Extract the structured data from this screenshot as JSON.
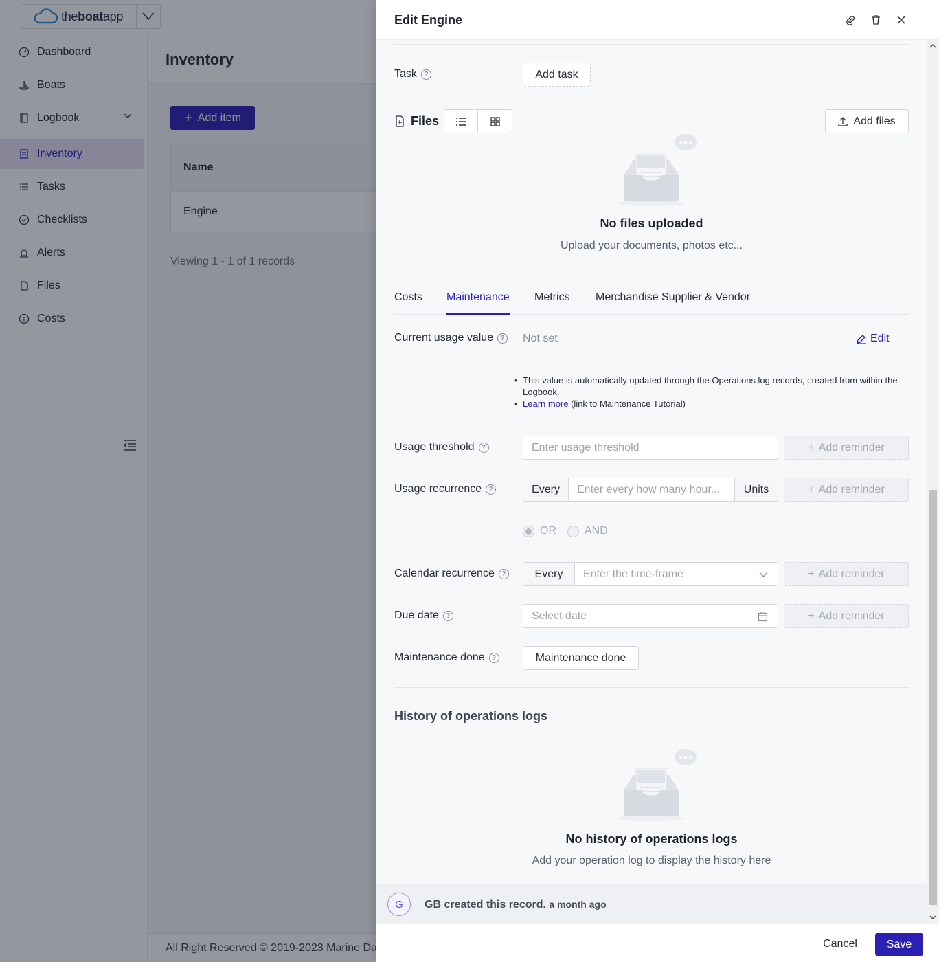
{
  "app": {
    "brand_light": "the",
    "brand_bold": "boat",
    "brand_tail": "app"
  },
  "sidebar": {
    "items": [
      {
        "label": "Dashboard",
        "icon": "dashboard-icon"
      },
      {
        "label": "Boats",
        "icon": "boat-icon"
      },
      {
        "label": "Logbook",
        "icon": "logbook-icon"
      },
      {
        "label": "Inventory",
        "icon": "inventory-icon"
      },
      {
        "label": "Tasks",
        "icon": "tasks-icon"
      },
      {
        "label": "Checklists",
        "icon": "checklist-icon"
      },
      {
        "label": "Alerts",
        "icon": "alert-icon"
      },
      {
        "label": "Files",
        "icon": "file-icon"
      },
      {
        "label": "Costs",
        "icon": "dollar-icon"
      }
    ],
    "active": "Inventory"
  },
  "main": {
    "title": "Inventory",
    "add_item_label": "Add item",
    "table": {
      "columns": [
        "Name"
      ],
      "rows": [
        [
          "Engine"
        ]
      ]
    },
    "viewing": "Viewing 1 - 1 of 1 records",
    "footer": "All Right Reserved © 2019-2023 Marine Da"
  },
  "drawer": {
    "title": "Edit Engine",
    "task": {
      "label": "Task",
      "button": "Add task"
    },
    "files": {
      "title": "Files",
      "add_button": "Add files",
      "empty_title": "No files uploaded",
      "empty_sub": "Upload your documents, photos etc..."
    },
    "tabs": [
      "Costs",
      "Maintenance",
      "Metrics",
      "Merchandise Supplier & Vendor"
    ],
    "active_tab": "Maintenance",
    "current_usage": {
      "label": "Current usage value",
      "value": "Not set",
      "edit": "Edit",
      "note1": "This value is automatically updated through the Operations log records, created from within the Logbook.",
      "note2_link": "Learn more",
      "note2_rest": " (link to Maintenance Tutorial)"
    },
    "usage_threshold": {
      "label": "Usage threshold",
      "placeholder": "Enter usage threshold",
      "reminder": "Add reminder"
    },
    "usage_recurrence": {
      "label": "Usage recurrence",
      "prefix": "Every",
      "placeholder": "Enter every how many hour...",
      "suffix": "Units",
      "reminder": "Add reminder"
    },
    "logic": {
      "or": "OR",
      "and": "AND",
      "selected": "OR"
    },
    "calendar_recurrence": {
      "label": "Calendar recurrence",
      "prefix": "Every",
      "placeholder": "Enter the time-frame",
      "reminder": "Add reminder"
    },
    "due_date": {
      "label": "Due date",
      "placeholder": "Select date",
      "reminder": "Add reminder"
    },
    "maintenance_done": {
      "label": "Maintenance done",
      "button": "Maintenance done"
    },
    "history": {
      "title": "History of operations logs",
      "empty_title": "No history of operations logs",
      "empty_sub": "Add your operation log to display the history here"
    },
    "activity": {
      "avatar": "G",
      "text": "GB created this record.",
      "ago": "a month ago"
    },
    "footer": {
      "cancel": "Cancel",
      "save": "Save"
    }
  },
  "colors": {
    "accent": "#2c1fb3",
    "active_nav_bg": "#e4e1f5"
  }
}
